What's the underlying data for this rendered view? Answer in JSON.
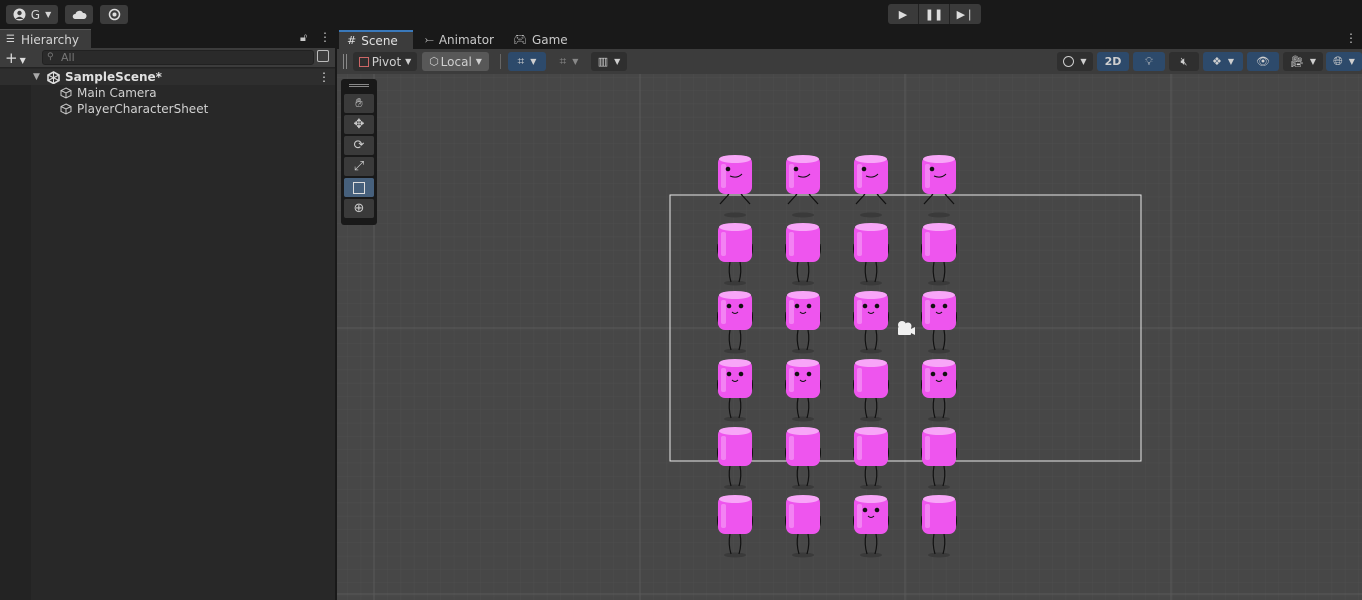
{
  "topbar": {
    "account_label": "G",
    "account_icon": "account-icon",
    "cloud_icon": "cloud-icon",
    "services_icon": "services-icon",
    "play_icon": "play-icon",
    "pause_icon": "pause-icon",
    "step_icon": "step-icon"
  },
  "hierarchy": {
    "tab_label": "Hierarchy",
    "search_placeholder": "All",
    "scene_name": "SampleScene*",
    "items": [
      {
        "label": "Main Camera"
      },
      {
        "label": "PlayerCharacterSheet"
      }
    ]
  },
  "scene": {
    "tabs": [
      {
        "label": "Scene",
        "icon": "grid-icon"
      },
      {
        "label": "Animator",
        "icon": "animator-icon"
      },
      {
        "label": "Game",
        "icon": "gamepad-icon"
      }
    ],
    "pivot_label": "Pivot",
    "local_label": "Local",
    "mode_2d_label": "2D",
    "tools": [
      "hand-tool",
      "move-tool",
      "rotate-tool",
      "scale-tool",
      "rect-tool",
      "transform-tool"
    ],
    "selected_tool": "rect-tool",
    "colors": {
      "viewport_bg": "#474747",
      "character_pink": "#ee55ee",
      "accent_blue": "#3a79bb"
    },
    "sprite_grid": {
      "rows": 6,
      "cols": 4
    }
  }
}
